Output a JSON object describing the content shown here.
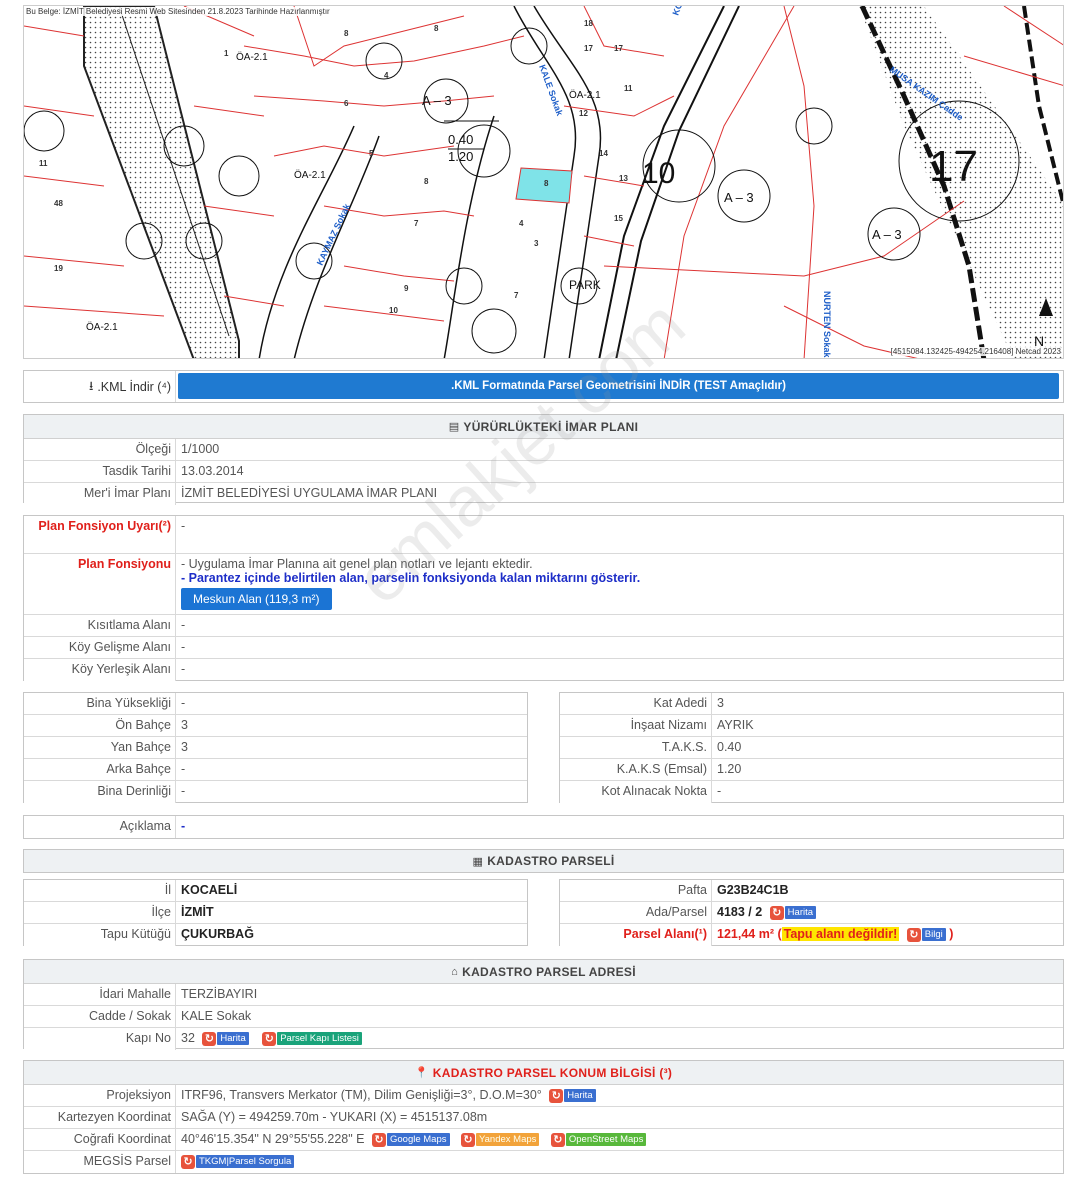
{
  "map": {
    "caption": "Bu Belge: İZMİT Belediyesi Resmi Web Sitesinden 21.8.2023 Tarihinde Hazırlanmıştır",
    "credit": "[4515084.132425-494254.216408] Netcad 2023",
    "labels": {
      "kale": "KALE Sokak",
      "kornis": "KORNİŞ Cadde",
      "musa": "MUSA KAZIM Cadde",
      "nurten": "NURTEN Sokak",
      "kaymaz": "KAYMAZ Sokak",
      "park": "PARK",
      "n": "N",
      "n17": "17",
      "n10": "10",
      "a3a": "A – 3",
      "a3b": "A – 3",
      "a3c": "A – 3",
      "taks": "0.40",
      "kaks": "1.20",
      "oa1": "ÖA-2.1",
      "oa2": "ÖA-2.1",
      "oa3": "ÖA-2.1",
      "oa4": "ÖA-2.1"
    }
  },
  "kml": {
    "label": ".KML İndir (⁴)",
    "button": ".KML Formatında Parsel Geometrisini İNDİR (TEST Amaçlıdır)"
  },
  "imar": {
    "title": "YÜRÜRLÜKTEKİ İMAR PLANI",
    "rows": [
      {
        "label": "Ölçeği",
        "value": "1/1000"
      },
      {
        "label": "Tasdik Tarihi",
        "value": "13.03.2014"
      },
      {
        "label": "Mer'i İmar Planı",
        "value": "İZMİT BELEDİYESİ UYGULAMA İMAR PLANI"
      }
    ]
  },
  "fonksiyon": {
    "uyari_label": "Plan Fonsiyon Uyarı(²)",
    "uyari_value": "-",
    "label": "Plan Fonsiyonu",
    "note1": "- Uygulama İmar Planına ait genel plan notları ve lejantı ektedir.",
    "note2": "- Parantez içinde belirtilen alan, parselin fonksiyonda kalan miktarını gösterir.",
    "button": "Meskun Alan (119,3 m²)",
    "rows": [
      {
        "label": "Kısıtlama Alanı",
        "value": "-"
      },
      {
        "label": "Köy Gelişme Alanı",
        "value": "-"
      },
      {
        "label": "Köy Yerleşik Alanı",
        "value": "-"
      }
    ]
  },
  "yapi_left": [
    {
      "label": "Bina Yüksekliği",
      "value": "-"
    },
    {
      "label": "Ön Bahçe",
      "value": "3"
    },
    {
      "label": "Yan Bahçe",
      "value": "3"
    },
    {
      "label": "Arka Bahçe",
      "value": "-"
    },
    {
      "label": "Bina Derinliği",
      "value": "-"
    }
  ],
  "yapi_right": [
    {
      "label": "Kat Adedi",
      "value": "3"
    },
    {
      "label": "İnşaat Nizamı",
      "value": "AYRIK"
    },
    {
      "label": "T.A.K.S.",
      "value": "0.40"
    },
    {
      "label": "K.A.K.S (Emsal)",
      "value": "1.20"
    },
    {
      "label": "Kot Alınacak Nokta",
      "value": "-"
    }
  ],
  "aciklama": {
    "label": "Açıklama",
    "value": "-"
  },
  "kadastro": {
    "title": "KADASTRO PARSELİ",
    "left": [
      {
        "label": "İl",
        "value": "KOCAELİ"
      },
      {
        "label": "İlçe",
        "value": "İZMİT"
      },
      {
        "label": "Tapu Kütüğü",
        "value": "ÇUKURBAĞ"
      }
    ],
    "pafta_label": "Pafta",
    "pafta_value": "G23B24C1B",
    "ada_label": "Ada/Parsel",
    "ada_value": "4183 / 2",
    "alan_label": "Parsel Alanı(¹)",
    "alan_value": "121,44 m²",
    "alan_warn": "Tapu alanı değildir!",
    "harita": "Harita",
    "bilgi": "Bilgi"
  },
  "adres": {
    "title": "KADASTRO PARSEL ADRESİ",
    "rows": [
      {
        "label": "İdari Mahalle",
        "value": "TERZİBAYIRI"
      },
      {
        "label": "Cadde / Sokak",
        "value": "KALE Sokak"
      }
    ],
    "kapi_label": "Kapı No",
    "kapi_value": "32",
    "harita": "Harita",
    "liste": "Parsel Kapı Listesi"
  },
  "konum": {
    "title": "KADASTRO PARSEL KONUM BİLGİSİ (³)",
    "proj_label": "Projeksiyon",
    "proj_value": "ITRF96, Transvers Merkator (TM), Dilim Genişliği=3°, D.O.M=30°",
    "harita": "Harita",
    "kart_label": "Kartezyen Koordinat",
    "kart_value": "SAĞA (Y) = 494259.70m - YUKARI (X) = 4515137.08m",
    "cog_label": "Coğrafi Koordinat",
    "cog_value": "40°46'15.354\" N 29°55'55.228\" E",
    "google": "Google Maps",
    "yandex": "Yandex Maps",
    "osm": "OpenStreet Maps",
    "megsis_label": "MEGSİS Parsel",
    "megsis": "TKGM|Parsel Sorgula"
  },
  "watermark": "emlakjet.com",
  "colors": {
    "accent": "#1b74d4",
    "warn": "#e0201b",
    "parcel": "#7fe3e8"
  }
}
